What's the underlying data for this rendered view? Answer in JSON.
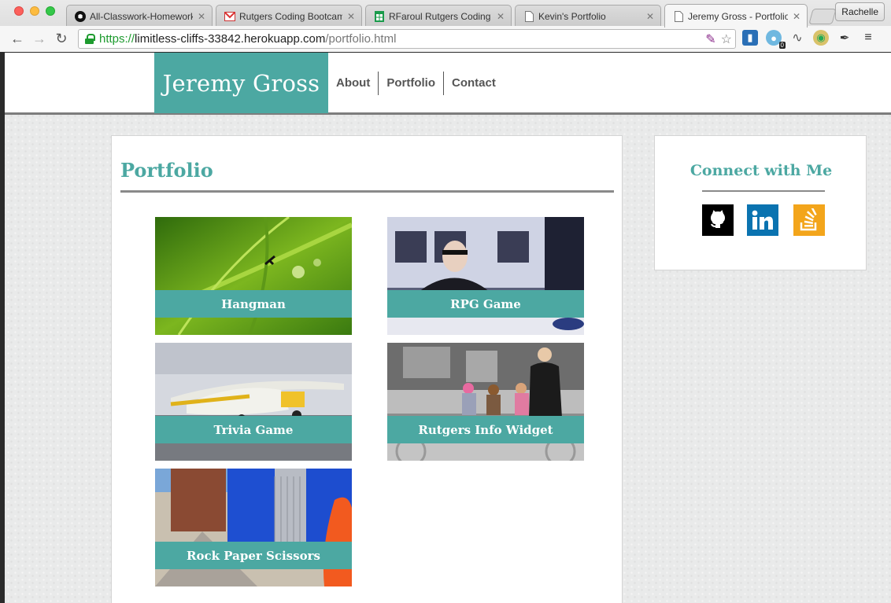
{
  "browser": {
    "tabs": [
      {
        "title": "All-Classwork-Homework",
        "icon": "github-icon",
        "active": false
      },
      {
        "title": "Rutgers Coding Bootcamp",
        "icon": "gmail-icon",
        "active": false
      },
      {
        "title": "RFaroul Rutgers Coding B",
        "icon": "sheets-icon",
        "active": false
      },
      {
        "title": "Kevin's Portfolio",
        "icon": "document-icon",
        "active": false
      },
      {
        "title": "Jeremy Gross - Portfolio",
        "icon": "document-icon",
        "active": true
      }
    ],
    "profile": "Rachelle",
    "url": {
      "scheme": "https://",
      "host": "limitless-cliffs-33842.herokuapp.com",
      "path": "/portfolio.html"
    },
    "extension_badge": "0"
  },
  "site": {
    "brand": "Jeremy Gross",
    "nav": [
      "About",
      "Portfolio",
      "Contact"
    ]
  },
  "main": {
    "title": "Portfolio",
    "projects": [
      {
        "label": "Hangman"
      },
      {
        "label": "RPG Game"
      },
      {
        "label": "Trivia Game"
      },
      {
        "label": "Rutgers Info Widget"
      },
      {
        "label": "Rock Paper Scissors"
      }
    ]
  },
  "sidebar": {
    "title": "Connect with Me",
    "links": [
      "github-icon",
      "linkedin-icon",
      "stackoverflow-icon"
    ]
  },
  "colors": {
    "accent": "#4ca8a2",
    "rule": "#8a8a8a",
    "linkedin": "#0a73b0",
    "stackoverflow": "#f3a51b"
  }
}
